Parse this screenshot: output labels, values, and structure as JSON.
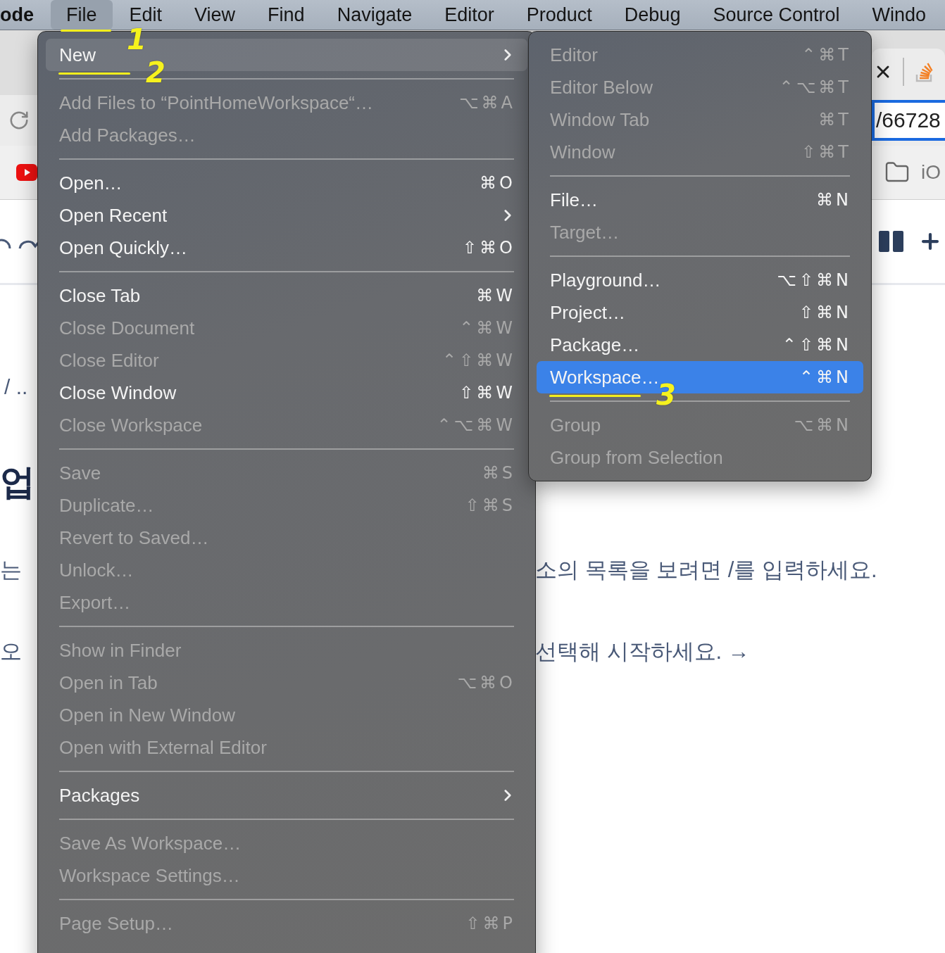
{
  "menubar": {
    "app": "ode",
    "items": [
      {
        "label": "File",
        "selected": true,
        "annotation": "1"
      },
      {
        "label": "Edit",
        "selected": false
      },
      {
        "label": "View",
        "selected": false
      },
      {
        "label": "Find",
        "selected": false
      },
      {
        "label": "Navigate",
        "selected": false
      },
      {
        "label": "Editor",
        "selected": false
      },
      {
        "label": "Product",
        "selected": false
      },
      {
        "label": "Debug",
        "selected": false
      },
      {
        "label": "Source Control",
        "selected": false
      },
      {
        "label": "Windo",
        "selected": false
      }
    ]
  },
  "browser": {
    "address": "/66728",
    "bookmark": "iO"
  },
  "page": {
    "breadcrumb": "/  ..",
    "heading": "업",
    "lines": [
      {
        "left": "는",
        "right": "소의 목록을 보려면 /를 입력하세요."
      },
      {
        "left": "오",
        "right": "선택해 시작하세요. →"
      }
    ]
  },
  "file_menu": {
    "items": [
      {
        "kind": "item",
        "label": "New",
        "enabled": true,
        "selected": true,
        "submenu": true,
        "annotation": "2"
      },
      {
        "kind": "separator"
      },
      {
        "kind": "item",
        "label": "Add Files to “PointHomeWorkspace“…",
        "shortcut": "⌥⌘A",
        "enabled": false,
        "selected": false
      },
      {
        "kind": "item",
        "label": "Add Packages…",
        "enabled": false,
        "selected": false
      },
      {
        "kind": "separator"
      },
      {
        "kind": "item",
        "label": "Open…",
        "shortcut": "⌘O",
        "enabled": true,
        "selected": false
      },
      {
        "kind": "item",
        "label": "Open Recent",
        "enabled": true,
        "selected": false,
        "submenu": true
      },
      {
        "kind": "item",
        "label": "Open Quickly…",
        "shortcut": "⇧⌘O",
        "enabled": true,
        "selected": false
      },
      {
        "kind": "separator"
      },
      {
        "kind": "item",
        "label": "Close Tab",
        "shortcut": "⌘W",
        "enabled": true,
        "selected": false
      },
      {
        "kind": "item",
        "label": "Close Document",
        "shortcut": "⌃⌘W",
        "enabled": false,
        "selected": false
      },
      {
        "kind": "item",
        "label": "Close Editor",
        "shortcut": "⌃⇧⌘W",
        "enabled": false,
        "selected": false
      },
      {
        "kind": "item",
        "label": "Close Window",
        "shortcut": "⇧⌘W",
        "enabled": true,
        "selected": false
      },
      {
        "kind": "item",
        "label": "Close Workspace",
        "shortcut": "⌃⌥⌘W",
        "enabled": false,
        "selected": false
      },
      {
        "kind": "separator"
      },
      {
        "kind": "item",
        "label": "Save",
        "shortcut": "⌘S",
        "enabled": false,
        "selected": false
      },
      {
        "kind": "item",
        "label": "Duplicate…",
        "shortcut": "⇧⌘S",
        "enabled": false,
        "selected": false
      },
      {
        "kind": "item",
        "label": "Revert to Saved…",
        "enabled": false,
        "selected": false
      },
      {
        "kind": "item",
        "label": "Unlock…",
        "enabled": false,
        "selected": false
      },
      {
        "kind": "item",
        "label": "Export…",
        "enabled": false,
        "selected": false
      },
      {
        "kind": "separator"
      },
      {
        "kind": "item",
        "label": "Show in Finder",
        "enabled": false,
        "selected": false
      },
      {
        "kind": "item",
        "label": "Open in Tab",
        "shortcut": "⌥⌘O",
        "enabled": false,
        "selected": false
      },
      {
        "kind": "item",
        "label": "Open in New Window",
        "enabled": false,
        "selected": false
      },
      {
        "kind": "item",
        "label": "Open with External Editor",
        "enabled": false,
        "selected": false
      },
      {
        "kind": "separator"
      },
      {
        "kind": "item",
        "label": "Packages",
        "enabled": true,
        "selected": false,
        "submenu": true
      },
      {
        "kind": "separator"
      },
      {
        "kind": "item",
        "label": "Save As Workspace…",
        "enabled": false,
        "selected": false
      },
      {
        "kind": "item",
        "label": "Workspace Settings…",
        "enabled": false,
        "selected": false
      },
      {
        "kind": "separator"
      },
      {
        "kind": "item",
        "label": "Page Setup…",
        "shortcut": "⇧⌘P",
        "enabled": false,
        "selected": false
      }
    ]
  },
  "new_submenu": {
    "items": [
      {
        "kind": "item",
        "label": "Editor",
        "shortcut": "⌃⌘T",
        "enabled": false,
        "selected": false
      },
      {
        "kind": "item",
        "label": "Editor Below",
        "shortcut": "⌃⌥⌘T",
        "enabled": false,
        "selected": false
      },
      {
        "kind": "item",
        "label": "Window Tab",
        "shortcut": "⌘T",
        "enabled": false,
        "selected": false
      },
      {
        "kind": "item",
        "label": "Window",
        "shortcut": "⇧⌘T",
        "enabled": false,
        "selected": false
      },
      {
        "kind": "separator"
      },
      {
        "kind": "item",
        "label": "File…",
        "shortcut": "⌘N",
        "enabled": true,
        "selected": false
      },
      {
        "kind": "item",
        "label": "Target…",
        "enabled": false,
        "selected": false
      },
      {
        "kind": "separator"
      },
      {
        "kind": "item",
        "label": "Playground…",
        "shortcut": "⌥⇧⌘N",
        "enabled": true,
        "selected": false
      },
      {
        "kind": "item",
        "label": "Project…",
        "shortcut": "⇧⌘N",
        "enabled": true,
        "selected": false
      },
      {
        "kind": "item",
        "label": "Package…",
        "shortcut": "⌃⇧⌘N",
        "enabled": true,
        "selected": false
      },
      {
        "kind": "item",
        "label": "Workspace…",
        "shortcut": "⌃⌘N",
        "enabled": true,
        "selected": true,
        "annotation": "3"
      },
      {
        "kind": "separator"
      },
      {
        "kind": "item",
        "label": "Group",
        "shortcut": "⌥⌘N",
        "enabled": false,
        "selected": false
      },
      {
        "kind": "item",
        "label": "Group from Selection",
        "enabled": false,
        "selected": false
      }
    ]
  }
}
